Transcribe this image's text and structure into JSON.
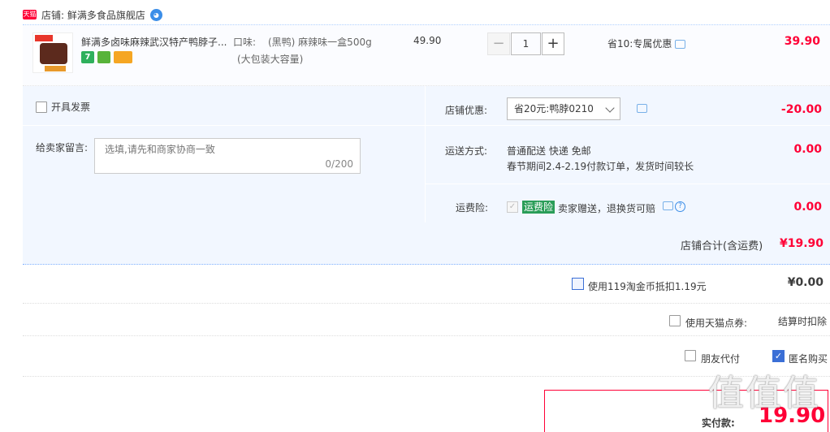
{
  "shop": {
    "logo_text": "天猫",
    "label": "店铺: 鲜满多食品旗舰店"
  },
  "item": {
    "title": "鲜满多卤味麻辣武汉特产鸭脖子...",
    "badge_text": "7",
    "sku_label": "口味:",
    "sku_value": "(黑鸭) 麻辣味一盒500g",
    "sku_extra": "(大包装大容量)",
    "unit_price": "49.90",
    "quantity": "1",
    "minus_label": "−",
    "plus_label": "+",
    "promo": "省10:专属优惠",
    "subtotal": "39.90"
  },
  "invoice": {
    "label": "开具发票"
  },
  "remark": {
    "label": "给卖家留言:",
    "placeholder": "选填,请先和商家协商一致",
    "count": "0/200"
  },
  "shop_discount": {
    "label": "店铺优惠:",
    "selected": "省20元:鸭脖0210",
    "value": "-20.00"
  },
  "shipping": {
    "label": "运送方式:",
    "line1": "普通配送 快递 免邮",
    "line2": "春节期间2.4-2.19付款订单，发货时间较长",
    "value": "0.00"
  },
  "insurance": {
    "label": "运费险:",
    "tag": "运费险",
    "text": "卖家赠送，退换货可赔",
    "help": "?",
    "value": "0.00"
  },
  "shop_total": {
    "label": "店铺合计(含运费)",
    "value": "¥19.90"
  },
  "coins": {
    "label": "使用119淘金币抵扣1.19元",
    "value": "¥0.00"
  },
  "voucher": {
    "label": "使用天猫点券:",
    "value": "结算时扣除"
  },
  "options": {
    "friend_pay": "朋友代付",
    "anonymous": "匿名购买"
  },
  "payment": {
    "label": "实付款:",
    "amount": "19.90"
  },
  "watermark": "值值值",
  "colors": {
    "accent_red": "#ff0036",
    "panel_blue": "#f2f7ff",
    "check_blue": "#3b6fd6"
  }
}
